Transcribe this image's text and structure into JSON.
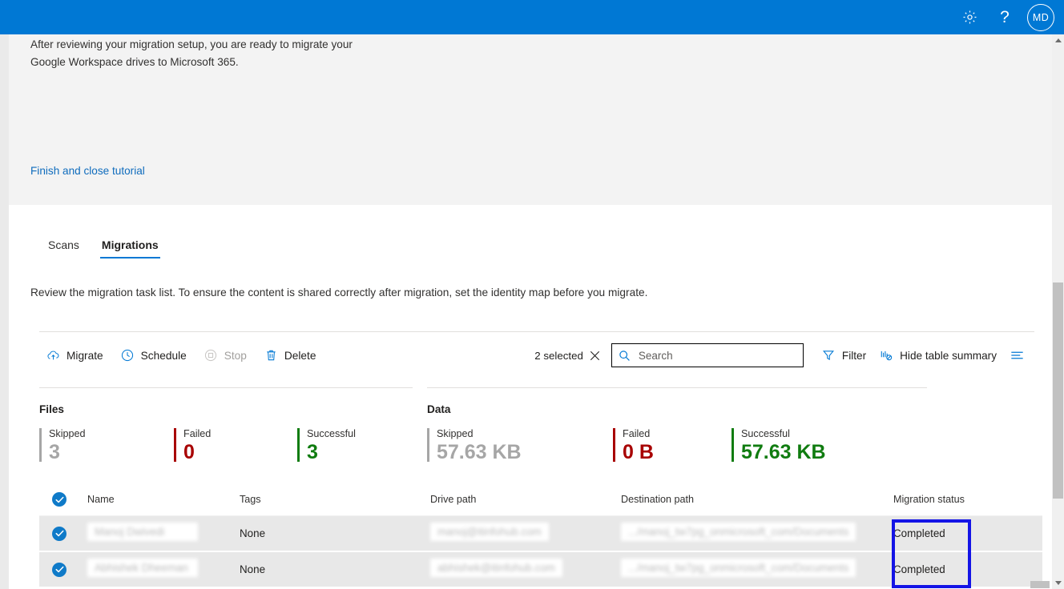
{
  "header": {
    "settings_icon": "gear-icon",
    "help_icon": "question-mark-icon",
    "help_label": "?",
    "avatar_initials": "MD",
    "background_color": "#0078d4"
  },
  "tutorial": {
    "body": "After reviewing your migration setup, you are ready to migrate your Google Workspace drives to Microsoft 365.",
    "link_label": "Finish and close tutorial",
    "link_color": "#0f6cbd",
    "background_color": "#f3f3f3"
  },
  "tabs": [
    {
      "label": "Scans",
      "active": false
    },
    {
      "label": "Migrations",
      "active": true
    }
  ],
  "main": {
    "subtitle": "Review the migration task list. To ensure the content is shared correctly after migration, set the identity map before you migrate."
  },
  "commandbar": {
    "buttons": [
      {
        "label": "Migrate",
        "icon": "cloud-upload-icon",
        "disabled": false
      },
      {
        "label": "Schedule",
        "icon": "clock-icon",
        "disabled": false
      },
      {
        "label": "Stop",
        "icon": "stop-square-icon",
        "disabled": true
      },
      {
        "label": "Delete",
        "icon": "trash-icon",
        "disabled": false
      }
    ],
    "selected_count_label": "2 selected",
    "clear_selection_icon": "close-icon",
    "search": {
      "placeholder": "Search",
      "value": "",
      "icon": "search-icon"
    },
    "filter_label": "Filter",
    "filter_icon": "funnel-icon",
    "hide_summary_label": "Hide table summary",
    "hide_summary_icon": "chart-hide-icon",
    "options_icon": "list-options-icon",
    "accent_color": "#0078d4"
  },
  "summary": {
    "files": {
      "title": "Files",
      "items": [
        {
          "label": "Skipped",
          "value": "3",
          "color": "#a6a6a6"
        },
        {
          "label": "Failed",
          "value": "0",
          "color": "#a80000"
        },
        {
          "label": "Successful",
          "value": "3",
          "color": "#107c10"
        }
      ]
    },
    "data": {
      "title": "Data",
      "items": [
        {
          "label": "Skipped",
          "value": "57.63 KB",
          "color": "#a6a6a6"
        },
        {
          "label": "Failed",
          "value": "0 B",
          "color": "#a80000"
        },
        {
          "label": "Successful",
          "value": "57.63 KB",
          "color": "#107c10"
        }
      ]
    }
  },
  "table": {
    "columns": [
      "Name",
      "Tags",
      "Drive path",
      "Destination path",
      "Migration status"
    ],
    "header_checkbox_checked": true,
    "rows": [
      {
        "checked": true,
        "name": "Manoj Dwivedi",
        "tags": "None",
        "drive_path": "manoj@itinfohub.com",
        "destination_path": ".../manoj_tw7pg_onmicrosoft_com/Documents",
        "migration_status": "Completed"
      },
      {
        "checked": true,
        "name": "Abhishek Dheeman",
        "tags": "None",
        "drive_path": "abhishek@itinfohub.com",
        "destination_path": ".../manoj_tw7pg_onmicrosoft_com/Documents",
        "migration_status": "Completed"
      }
    ]
  },
  "annotation": {
    "color": "#1414e6",
    "target": "migration-status-column"
  }
}
